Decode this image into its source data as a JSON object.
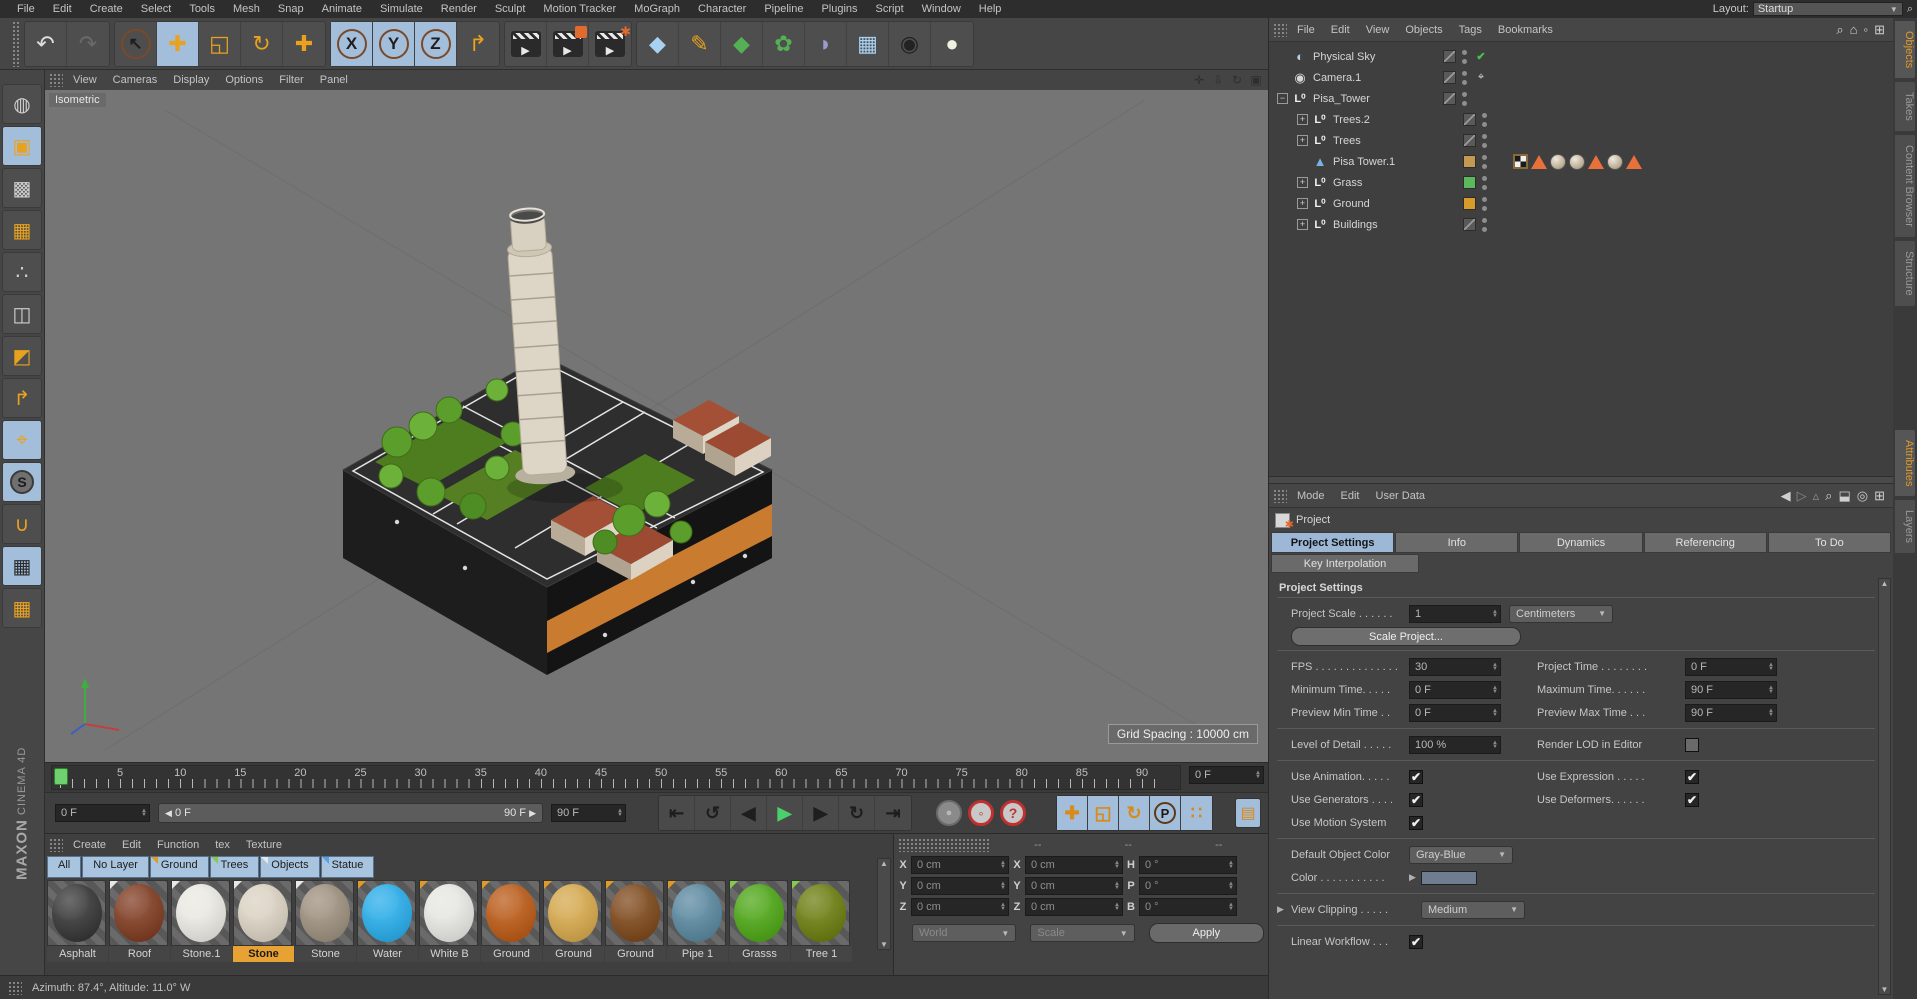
{
  "accent": {
    "orange": "#e8a21e",
    "selection_blue": "#a3bedb",
    "green_check": "#49c24d"
  },
  "menu_bar": {
    "items": [
      "File",
      "Edit",
      "Create",
      "Select",
      "Tools",
      "Mesh",
      "Snap",
      "Animate",
      "Simulate",
      "Render",
      "Sculpt",
      "Motion Tracker",
      "MoGraph",
      "Character",
      "Pipeline",
      "Plugins",
      "Script",
      "Window",
      "Help"
    ],
    "layout_label": "Layout:",
    "layout_value": "Startup",
    "search_icon": "search-icon"
  },
  "toolbar": {
    "groups": [
      {
        "icons": [
          {
            "name": "undo-icon",
            "glyph": "↶",
            "style": "plain"
          },
          {
            "name": "redo-icon",
            "glyph": "↷",
            "style": "disabled"
          }
        ]
      },
      {
        "icons": [
          {
            "name": "live-selection-icon",
            "glyph": "↖",
            "style": "ring"
          },
          {
            "name": "move-tool-icon",
            "glyph": "✚",
            "style": "orange",
            "active": true
          },
          {
            "name": "scale-tool-icon",
            "glyph": "◱",
            "style": "orange"
          },
          {
            "name": "rotate-tool-icon",
            "glyph": "↻",
            "style": "orange"
          },
          {
            "name": "last-used-tool-icon",
            "glyph": "✚",
            "style": "orange"
          }
        ]
      },
      {
        "icons": [
          {
            "name": "lock-x-axis-icon",
            "glyph": "X",
            "style": "ring",
            "active": true
          },
          {
            "name": "lock-y-axis-icon",
            "glyph": "Y",
            "style": "ring",
            "active": true
          },
          {
            "name": "lock-z-axis-icon",
            "glyph": "Z",
            "style": "ring",
            "active": true
          },
          {
            "name": "coordinate-system-icon",
            "glyph": "↱",
            "style": "orange"
          }
        ]
      },
      {
        "icons": [
          {
            "name": "render-view-icon",
            "glyph": "▶",
            "style": "clapper"
          },
          {
            "name": "render-picture-viewer-icon",
            "glyph": "▶",
            "style": "clapper corner"
          },
          {
            "name": "render-settings-icon",
            "glyph": "▶",
            "style": "clapper gear"
          }
        ]
      },
      {
        "icons": [
          {
            "name": "add-cube-object-icon",
            "glyph": "◆",
            "style": "blue"
          },
          {
            "name": "spline-pen-icon",
            "glyph": "✎",
            "style": "orange"
          },
          {
            "name": "subdivision-surface-icon",
            "glyph": "◆",
            "style": "green"
          },
          {
            "name": "mograph-cloner-icon",
            "glyph": "✿",
            "style": "green"
          },
          {
            "name": "deformer-icon",
            "glyph": "◗",
            "style": "violet"
          },
          {
            "name": "environment-floor-icon",
            "glyph": "▦",
            "style": "blue"
          },
          {
            "name": "camera-object-icon",
            "glyph": "◉",
            "style": "dark"
          },
          {
            "name": "light-object-icon",
            "glyph": "●",
            "style": "light"
          }
        ]
      }
    ]
  },
  "left_toolbar": {
    "icons": [
      {
        "name": "make-editable-icon",
        "glyph": "◍",
        "style": "plain"
      },
      {
        "name": "model-mode-icon",
        "glyph": "▣",
        "style": "orange",
        "active": true
      },
      {
        "name": "texture-mode-icon",
        "glyph": "▩",
        "style": "plain"
      },
      {
        "name": "workplane-mode-icon",
        "glyph": "▦",
        "style": "orange"
      },
      {
        "name": "points-mode-icon",
        "glyph": "∴",
        "style": "plain"
      },
      {
        "name": "edge-mode-icon",
        "glyph": "◫",
        "style": "plain"
      },
      {
        "name": "polygon-mode-icon",
        "glyph": "◩",
        "style": "orange"
      },
      {
        "name": "object-axis-mode-icon",
        "glyph": "↱",
        "style": "orange"
      },
      {
        "name": "tweak-mode-icon",
        "glyph": "⌖",
        "style": "orange",
        "active": true
      },
      {
        "name": "viewport-solo-icon",
        "glyph": "S",
        "style": "circle",
        "active": true
      },
      {
        "name": "snap-icon",
        "glyph": "∪",
        "style": "orange"
      },
      {
        "name": "lock-workplane-icon",
        "glyph": "▦",
        "style": "plain",
        "active": true
      },
      {
        "name": "align-workplane-icon",
        "glyph": "▦",
        "style": "orange"
      }
    ],
    "brand_top": "MAXON",
    "brand_bottom": "CINEMA 4D"
  },
  "viewport": {
    "menu": [
      "View",
      "Cameras",
      "Display",
      "Options",
      "Filter",
      "Panel"
    ],
    "corner_icons": [
      {
        "name": "pan-view-icon",
        "glyph": "✛"
      },
      {
        "name": "zoom-view-icon",
        "glyph": "⇩"
      },
      {
        "name": "rotate-view-icon",
        "glyph": "↻"
      },
      {
        "name": "toggle-view-icon",
        "glyph": "▣"
      }
    ],
    "view_label": "Isometric",
    "grid_spacing": "Grid Spacing : 10000 cm"
  },
  "object_manager": {
    "menu": [
      "File",
      "Edit",
      "View",
      "Objects",
      "Tags",
      "Bookmarks"
    ],
    "corner_icons": [
      {
        "name": "om-search-icon",
        "glyph": "⌕"
      },
      {
        "name": "om-home-icon",
        "glyph": "⌂"
      },
      {
        "name": "om-filter-icon",
        "glyph": "◦"
      },
      {
        "name": "om-add-panel-icon",
        "glyph": "⊞"
      }
    ],
    "objects": [
      {
        "name": "Physical Sky",
        "icon": "sky",
        "glyph": "◐",
        "indent": 0,
        "expand": null,
        "swatch": "layer",
        "extra": "check"
      },
      {
        "name": "Camera.1",
        "icon": "camera",
        "glyph": "◉",
        "indent": 0,
        "expand": null,
        "swatch": "layer",
        "extra": "target"
      },
      {
        "name": "Pisa_Tower",
        "icon": "null",
        "glyph": "L⁰",
        "indent": 0,
        "expand": "minus",
        "swatch": "layer",
        "extra": null
      },
      {
        "name": "Trees.2",
        "icon": "null",
        "glyph": "L⁰",
        "indent": 1,
        "expand": "plus",
        "swatch": "layer",
        "extra": null
      },
      {
        "name": "Trees",
        "icon": "null",
        "glyph": "L⁰",
        "indent": 1,
        "expand": "plus",
        "swatch": "layer",
        "extra": null
      },
      {
        "name": "Pisa Tower.1",
        "icon": "mesh",
        "glyph": "▲",
        "indent": 1,
        "expand": null,
        "swatch": "#c49a52",
        "extra": null,
        "tags": [
          "uvw-tag",
          "selection-tag",
          "material-tag",
          "material-tag",
          "selection-tag",
          "material-tag",
          "selection-tag"
        ]
      },
      {
        "name": "Grass",
        "icon": "null",
        "glyph": "L⁰",
        "indent": 1,
        "expand": "plus",
        "swatch": "#5cb85c",
        "extra": null
      },
      {
        "name": "Ground",
        "icon": "null",
        "glyph": "L⁰",
        "indent": 1,
        "expand": "plus",
        "swatch": "#d89c2a",
        "extra": null
      },
      {
        "name": "Buildings",
        "icon": "null",
        "glyph": "L⁰",
        "indent": 1,
        "expand": "plus",
        "swatch": "layer",
        "extra": null
      }
    ]
  },
  "attribute_manager": {
    "menu": [
      "Mode",
      "Edit",
      "User Data"
    ],
    "corner_icons": [
      {
        "name": "am-back-icon",
        "glyph": "◀"
      },
      {
        "name": "am-forward-icon",
        "glyph": "▷",
        "dim": true
      },
      {
        "name": "am-parent-icon",
        "glyph": "▵",
        "dim": true
      },
      {
        "name": "am-search-icon",
        "glyph": "⌕"
      },
      {
        "name": "am-lock-icon",
        "glyph": "⬓"
      },
      {
        "name": "am-target-icon",
        "glyph": "◎"
      },
      {
        "name": "am-add-panel-icon",
        "glyph": "⊞"
      }
    ],
    "title": "Project",
    "tabs": [
      "Project Settings",
      "Info",
      "Dynamics",
      "Referencing",
      "To Do"
    ],
    "active_tab": "Project Settings",
    "tabs_row2": [
      "Key Interpolation"
    ],
    "section_title": "Project Settings",
    "rows": [
      {
        "t": "row1",
        "name": "project-scale",
        "label": "Project Scale . . . . . .",
        "widget": "spinner",
        "value": "1",
        "extra_widget": "dropdown",
        "extra_value": "Centimeters"
      },
      {
        "t": "button",
        "name": "scale-project",
        "label": "Scale Project..."
      },
      {
        "t": "hr"
      },
      {
        "t": "pair",
        "l": {
          "name": "fps",
          "label": "FPS . . . . . . . . . . . . . .",
          "w": "spinner",
          "v": "30"
        },
        "r": {
          "name": "project-time",
          "label": "Project Time . . . . . . . .",
          "w": "spinner",
          "v": "0 F"
        }
      },
      {
        "t": "pair",
        "l": {
          "name": "minimum-time",
          "label": "Minimum Time. . . . .",
          "w": "spinner",
          "v": "0 F"
        },
        "r": {
          "name": "maximum-time",
          "label": "Maximum Time. . . . . .",
          "w": "spinner",
          "v": "90 F"
        }
      },
      {
        "t": "pair",
        "l": {
          "name": "preview-min-time",
          "label": "Preview Min Time . .",
          "w": "spinner",
          "v": "0 F"
        },
        "r": {
          "name": "preview-max-time",
          "label": "Preview Max Time . . .",
          "w": "spinner",
          "v": "90 F"
        }
      },
      {
        "t": "hr"
      },
      {
        "t": "pair",
        "l": {
          "name": "level-of-detail",
          "label": "Level of Detail . . . . .",
          "w": "spinner",
          "v": "100 %"
        },
        "r": {
          "name": "render-lod-in-editor",
          "label": "Render LOD in Editor",
          "w": "checkbox",
          "v": false
        }
      },
      {
        "t": "hr"
      },
      {
        "t": "pair",
        "l": {
          "name": "use-animation",
          "label": "Use Animation. . . . .",
          "w": "checkbox",
          "v": true
        },
        "r": {
          "name": "use-expression",
          "label": "Use Expression . . . . .",
          "w": "checkbox",
          "v": true
        }
      },
      {
        "t": "pair",
        "l": {
          "name": "use-generators",
          "label": "Use Generators . . . .",
          "w": "checkbox",
          "v": true
        },
        "r": {
          "name": "use-deformers",
          "label": "Use Deformers. . . . . .",
          "w": "checkbox",
          "v": true
        }
      },
      {
        "t": "pair",
        "l": {
          "name": "use-motion-system",
          "label": "Use Motion System",
          "w": "checkbox",
          "v": true
        },
        "r": null
      },
      {
        "t": "hr"
      },
      {
        "t": "row1",
        "name": "default-object-color",
        "label": "Default Object Color",
        "widget": "dropdown",
        "value": "Gray-Blue"
      },
      {
        "t": "row1",
        "name": "color",
        "label": "Color . . . . . . . . . . .",
        "widget": "swatch",
        "value": "#6e7e90",
        "arrow": true
      },
      {
        "t": "hr"
      },
      {
        "t": "row1",
        "name": "view-clipping",
        "label": "View Clipping . . . . .",
        "widget": "dropdown",
        "value": "Medium",
        "caret": true
      },
      {
        "t": "hr"
      },
      {
        "t": "row1",
        "name": "linear-workflow",
        "label": "Linear Workflow . . .",
        "widget": "checkbox",
        "value": true
      }
    ]
  },
  "timeline": {
    "tick_labels": [
      "0",
      "5",
      "10",
      "15",
      "20",
      "25",
      "30",
      "35",
      "40",
      "45",
      "50",
      "55",
      "60",
      "65",
      "70",
      "75",
      "80",
      "85",
      "90"
    ],
    "max_frame": 92,
    "current_frame_box": "0 F"
  },
  "transport": {
    "frame_spinner": "0 F",
    "range_start": "0 F",
    "range_end": "90 F",
    "range_end_spinner": "90 F",
    "buttons": [
      {
        "name": "goto-start-button",
        "glyph": "⇤"
      },
      {
        "name": "previous-key-button",
        "glyph": "↺"
      },
      {
        "name": "previous-frame-button",
        "glyph": "◀"
      },
      {
        "name": "play-button",
        "glyph": "▶",
        "style": "play"
      },
      {
        "name": "next-frame-button",
        "glyph": "▶"
      },
      {
        "name": "next-key-button",
        "glyph": "↻"
      },
      {
        "name": "goto-end-button",
        "glyph": "⇥"
      }
    ],
    "circle_buttons": [
      {
        "name": "record-button",
        "glyph": "●",
        "style": "gray"
      },
      {
        "name": "autokey-button",
        "glyph": "◦",
        "style": "red"
      },
      {
        "name": "keyframe-help-button",
        "glyph": "?",
        "style": "red"
      }
    ],
    "key_buttons": [
      {
        "name": "key-position-button",
        "glyph": "✚"
      },
      {
        "name": "key-scale-button",
        "glyph": "◱"
      },
      {
        "name": "key-rotation-button",
        "glyph": "↻"
      },
      {
        "name": "key-parameter-button",
        "glyph": "P",
        "ring": true
      },
      {
        "name": "key-pla-button",
        "glyph": "∷"
      }
    ],
    "fcurve_button": {
      "name": "timeline-window-button",
      "glyph": "▤"
    }
  },
  "material_manager": {
    "menu": [
      "Create",
      "Edit",
      "Function",
      "tex",
      "Texture"
    ],
    "layer_tabs": [
      {
        "label": "All",
        "corner": null
      },
      {
        "label": "No Layer",
        "corner": null
      },
      {
        "label": "Ground",
        "corner": "#e09a28"
      },
      {
        "label": "Trees",
        "corner": "#86c850"
      },
      {
        "label": "Objects",
        "corner": "#e8e8e8"
      },
      {
        "label": "Statue",
        "corner": "#5aa0e8"
      }
    ],
    "materials": [
      {
        "name": "Asphalt",
        "color": "#4a4a4a",
        "corner": null,
        "selected": false
      },
      {
        "name": "Roof",
        "color": "#8c4f38",
        "corner": "#e8e8e8",
        "selected": false
      },
      {
        "name": "Stone.1",
        "color": "#eceae4",
        "corner": "#e8e8e8",
        "selected": false
      },
      {
        "name": "Stone",
        "color": "#ddd6c8",
        "corner": "#e8e8e8",
        "selected": true
      },
      {
        "name": "Stone",
        "color": "#a69a8a",
        "corner": "#e8e8e8",
        "selected": false
      },
      {
        "name": "Water",
        "color": "#3eb4ea",
        "corner": "#e09a28",
        "selected": false
      },
      {
        "name": "White B",
        "color": "#e8e8e4",
        "corner": "#e09a28",
        "selected": false
      },
      {
        "name": "Ground",
        "color": "#c06a2e",
        "corner": "#e09a28",
        "selected": false
      },
      {
        "name": "Ground",
        "color": "#d8b05e",
        "corner": "#e09a28",
        "selected": false
      },
      {
        "name": "Ground",
        "color": "#8a5a32",
        "corner": "#e09a28",
        "selected": false
      },
      {
        "name": "Pipe 1",
        "color": "#6a93a8",
        "corner": "#e09a28",
        "selected": false
      },
      {
        "name": "Grasss",
        "color": "#5fae2e",
        "corner": "#86c850",
        "selected": false
      },
      {
        "name": "Tree 1",
        "color": "#7a8a28",
        "corner": "#86c850",
        "selected": false
      }
    ]
  },
  "coordinates_panel": {
    "headers": [
      "--",
      "--",
      "--"
    ],
    "rows": [
      {
        "a1": "X",
        "v1": "0 cm",
        "a2": "X",
        "v2": "0 cm",
        "a3": "H",
        "v3": "0 °"
      },
      {
        "a1": "Y",
        "v1": "0 cm",
        "a2": "Y",
        "v2": "0 cm",
        "a3": "P",
        "v3": "0 °"
      },
      {
        "a1": "Z",
        "v1": "0 cm",
        "a2": "Z",
        "v2": "0 cm",
        "a3": "B",
        "v3": "0 °"
      }
    ],
    "dropdown_left": "World",
    "dropdown_right": "Scale",
    "apply_label": "Apply"
  },
  "status_bar": {
    "text": "Azimuth: 87.4°, Altitude: 11.0°  W"
  },
  "edge_tabs": {
    "top": [
      {
        "label": "Objects",
        "active": true
      },
      {
        "label": "Takes",
        "active": false
      },
      {
        "label": "Content Browser",
        "active": false
      },
      {
        "label": "Structure",
        "active": false
      }
    ],
    "bottom": [
      {
        "label": "Attributes",
        "active": true
      },
      {
        "label": "Layers",
        "active": false
      }
    ]
  }
}
